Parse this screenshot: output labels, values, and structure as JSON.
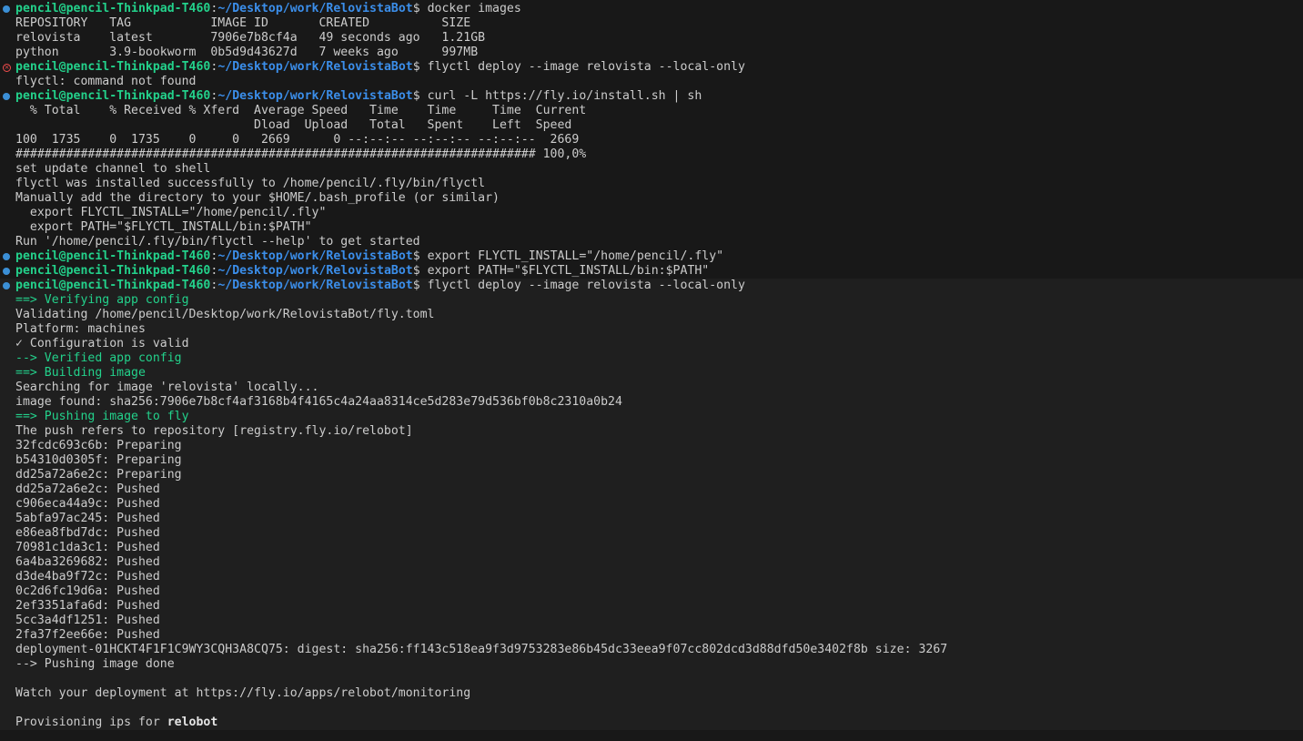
{
  "prompt": {
    "user": "pencil@pencil-Thinkpad-T460",
    "sep": ":",
    "path": "~/Desktop/work/RelovistaBot",
    "sym": "$ "
  },
  "lines": [
    {
      "kind": "prompt",
      "marker": "ok",
      "cmd": "docker images"
    },
    {
      "kind": "out",
      "text": "REPOSITORY   TAG           IMAGE ID       CREATED          SIZE"
    },
    {
      "kind": "out",
      "text": "relovista    latest        7906e7b8cf4a   49 seconds ago   1.21GB"
    },
    {
      "kind": "out",
      "text": "python       3.9-bookworm  0b5d9d43627d   7 weeks ago      997MB"
    },
    {
      "kind": "prompt",
      "marker": "err",
      "cmd": "flyctl deploy --image relovista --local-only"
    },
    {
      "kind": "out",
      "text": "flyctl: command not found"
    },
    {
      "kind": "prompt",
      "marker": "ok",
      "cmd": "curl -L https://fly.io/install.sh | sh"
    },
    {
      "kind": "out",
      "text": "  % Total    % Received % Xferd  Average Speed   Time    Time     Time  Current"
    },
    {
      "kind": "out",
      "text": "                                 Dload  Upload   Total   Spent    Left  Speed"
    },
    {
      "kind": "out",
      "text": "100  1735    0  1735    0     0   2669      0 --:--:-- --:--:-- --:--:--  2669"
    },
    {
      "kind": "out",
      "text": "######################################################################## 100,0%"
    },
    {
      "kind": "out",
      "text": "set update channel to shell"
    },
    {
      "kind": "out",
      "text": "flyctl was installed successfully to /home/pencil/.fly/bin/flyctl"
    },
    {
      "kind": "out",
      "text": "Manually add the directory to your $HOME/.bash_profile (or similar)"
    },
    {
      "kind": "out",
      "text": "  export FLYCTL_INSTALL=\"/home/pencil/.fly\""
    },
    {
      "kind": "out",
      "text": "  export PATH=\"$FLYCTL_INSTALL/bin:$PATH\""
    },
    {
      "kind": "out",
      "text": "Run '/home/pencil/.fly/bin/flyctl --help' to get started"
    },
    {
      "kind": "prompt",
      "marker": "ok",
      "cmd": "export FLYCTL_INSTALL=\"/home/pencil/.fly\""
    },
    {
      "kind": "prompt",
      "marker": "ok",
      "cmd": "export PATH=\"$FLYCTL_INSTALL/bin:$PATH\""
    },
    {
      "kind": "prompt",
      "marker": "ok",
      "cmd": "flyctl deploy --image relovista --local-only"
    },
    {
      "kind": "green",
      "text": "==> Verifying app config"
    },
    {
      "kind": "out",
      "text": "Validating /home/pencil/Desktop/work/RelovistaBot/fly.toml"
    },
    {
      "kind": "out",
      "text": "Platform: machines"
    },
    {
      "kind": "out",
      "text": "✓ Configuration is valid"
    },
    {
      "kind": "green",
      "text": "--> Verified app config"
    },
    {
      "kind": "green",
      "text": "==> Building image"
    },
    {
      "kind": "out",
      "text": "Searching for image 'relovista' locally..."
    },
    {
      "kind": "out",
      "text": "image found: sha256:7906e7b8cf4af3168b4f4165c4a24aa8314ce5d283e79d536bf0b8c2310a0b24"
    },
    {
      "kind": "green",
      "text": "==> Pushing image to fly"
    },
    {
      "kind": "out",
      "text": "The push refers to repository [registry.fly.io/relobot]"
    },
    {
      "kind": "out",
      "text": "32fcdc693c6b: Preparing"
    },
    {
      "kind": "out",
      "text": "b54310d0305f: Preparing"
    },
    {
      "kind": "out",
      "text": "dd25a72a6e2c: Preparing"
    },
    {
      "kind": "out",
      "text": "dd25a72a6e2c: Pushed"
    },
    {
      "kind": "out",
      "text": "c906eca44a9c: Pushed"
    },
    {
      "kind": "out",
      "text": "5abfa97ac245: Pushed"
    },
    {
      "kind": "out",
      "text": "e86ea8fbd7dc: Pushed"
    },
    {
      "kind": "out",
      "text": "70981c1da3c1: Pushed"
    },
    {
      "kind": "out",
      "text": "6a4ba3269682: Pushed"
    },
    {
      "kind": "out",
      "text": "d3de4ba9f72c: Pushed"
    },
    {
      "kind": "out",
      "text": "0c2d6fc19d6a: Pushed"
    },
    {
      "kind": "out",
      "text": "2ef3351afa6d: Pushed"
    },
    {
      "kind": "out",
      "text": "5cc3a4df1251: Pushed"
    },
    {
      "kind": "out",
      "text": "2fa37f2ee66e: Pushed"
    },
    {
      "kind": "out",
      "text": "deployment-01HCKT4F1F1C9WY3CQH3A8CQ75: digest: sha256:ff143c518ea9f3d9753283e86b45dc33eea9f07cc802dcd3d88dfd50e3402f8b size: 3267"
    },
    {
      "kind": "out",
      "text": "--> Pushing image done"
    },
    {
      "kind": "out",
      "text": ""
    },
    {
      "kind": "out",
      "text": "Watch your deployment at https://fly.io/apps/relobot/monitoring"
    },
    {
      "kind": "out",
      "text": ""
    },
    {
      "kind": "mixed",
      "text": "Provisioning ips for ",
      "bold": "relobot"
    }
  ],
  "colors": {
    "background": "#181818",
    "active_background": "#1f1f1f",
    "user": "#23d18b",
    "path": "#3b8eea",
    "success_marker": "#3b8fd6",
    "error_marker": "#f14c4c",
    "text": "#cccccc"
  }
}
